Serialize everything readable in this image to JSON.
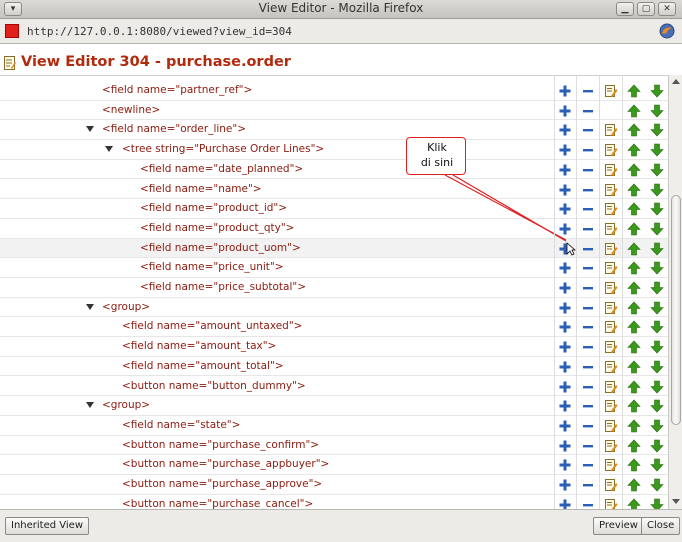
{
  "window": {
    "title": "View Editor - Mozilla Firefox",
    "menu_glyph": "▾",
    "minimize_glyph": "▁",
    "maximize_glyph": "▢",
    "close_glyph": "✕"
  },
  "urlbar": {
    "url": "http://127.0.0.1:8080/viewed?view_id=304"
  },
  "header": {
    "title": "View Editor 304 - purchase.order"
  },
  "tree": {
    "rows": [
      {
        "label": "<field name=\"partner_ref\">"
      },
      {
        "label": "<newline>"
      },
      {
        "label": "<field name=\"order_line\">"
      },
      {
        "label": "<tree string=\"Purchase Order Lines\">"
      },
      {
        "label": "<field name=\"date_planned\">"
      },
      {
        "label": "<field name=\"name\">"
      },
      {
        "label": "<field name=\"product_id\">"
      },
      {
        "label": "<field name=\"product_qty\">"
      },
      {
        "label": "<field name=\"product_uom\">"
      },
      {
        "label": "<field name=\"price_unit\">"
      },
      {
        "label": "<field name=\"price_subtotal\">"
      },
      {
        "label": "<group>"
      },
      {
        "label": "<field name=\"amount_untaxed\">"
      },
      {
        "label": "<field name=\"amount_tax\">"
      },
      {
        "label": "<field name=\"amount_total\">"
      },
      {
        "label": "<button name=\"button_dummy\">"
      },
      {
        "label": "<group>"
      },
      {
        "label": "<field name=\"state\">"
      },
      {
        "label": "<button name=\"purchase_confirm\">"
      },
      {
        "label": "<button name=\"purchase_appbuyer\">"
      },
      {
        "label": "<button name=\"purchase_approve\">"
      },
      {
        "label": "<button name=\"purchase_cancel\">"
      }
    ]
  },
  "callout": {
    "line1": "Klik",
    "line2": "di sini"
  },
  "bottom": {
    "inherited_label": "Inherited View",
    "preview_label": "Preview",
    "close_label": "Close"
  },
  "colors": {
    "title_red": "#b22a0e",
    "node_text": "#8b1a0e",
    "plus_blue": "#2a5fb8",
    "arrow_green": "#3a9a1a",
    "callout_red": "#e02020"
  }
}
